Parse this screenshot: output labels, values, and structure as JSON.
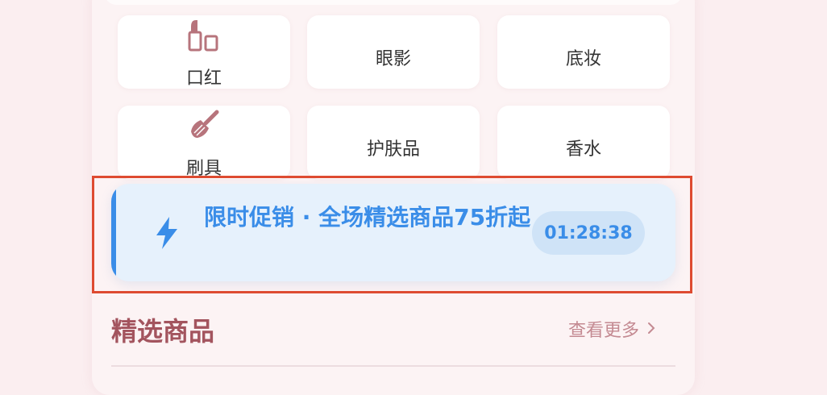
{
  "categories": [
    {
      "label": "口红",
      "icon": "lipstick-icon"
    },
    {
      "label": "眼影",
      "icon": null
    },
    {
      "label": "底妆",
      "icon": null
    },
    {
      "label": "刷具",
      "icon": "makeup-brush-icon"
    },
    {
      "label": "护肤品",
      "icon": null
    },
    {
      "label": "香水",
      "icon": null
    }
  ],
  "promo": {
    "text": "限时促销 · 全场精选商品75折起",
    "countdown": "01:28:38",
    "icon": "lightning-icon"
  },
  "featured": {
    "title": "精选商品",
    "more_label": "查看更多",
    "more_icon": "chevron-right-icon"
  },
  "colors": {
    "accent_blue": "#3a8de8",
    "promo_bg": "#e6f1fc",
    "title_rose": "#a3545e",
    "highlight_outline": "#de4b31"
  }
}
